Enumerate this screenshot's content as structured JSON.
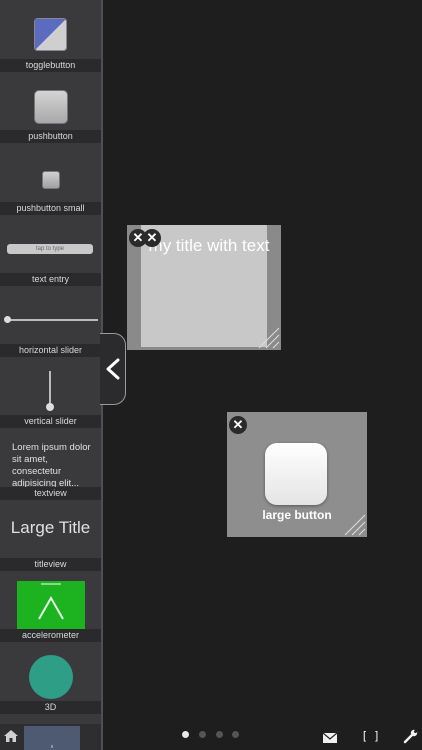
{
  "palette": {
    "togglebutton": "togglebutton",
    "pushbutton": "pushbutton",
    "pushbutton_small": "pushbutton small",
    "text_entry": "text entry",
    "text_entry_placeholder": "tap to type",
    "horizontal_slider": "horizontal slider",
    "vertical_slider": "vertical slider",
    "textview": "textview",
    "textview_sample": "Lorem ipsum dolor sit amet, consectetur adipisicing elit...",
    "titleview": "titleview",
    "titleview_sample": "Large Title",
    "accelerometer": "accelerometer",
    "three_d": "3D"
  },
  "widgets": {
    "title_widget_text": "my title with text",
    "button_widget_label": "large button"
  },
  "bottom_bar": {
    "frame_label": "[ ]",
    "page_count": 4,
    "active_page": 0
  },
  "colors": {
    "accelerometer_green": "#1db320",
    "teal": "#2f9e86",
    "toggle_blue": "#5a6bc0"
  }
}
